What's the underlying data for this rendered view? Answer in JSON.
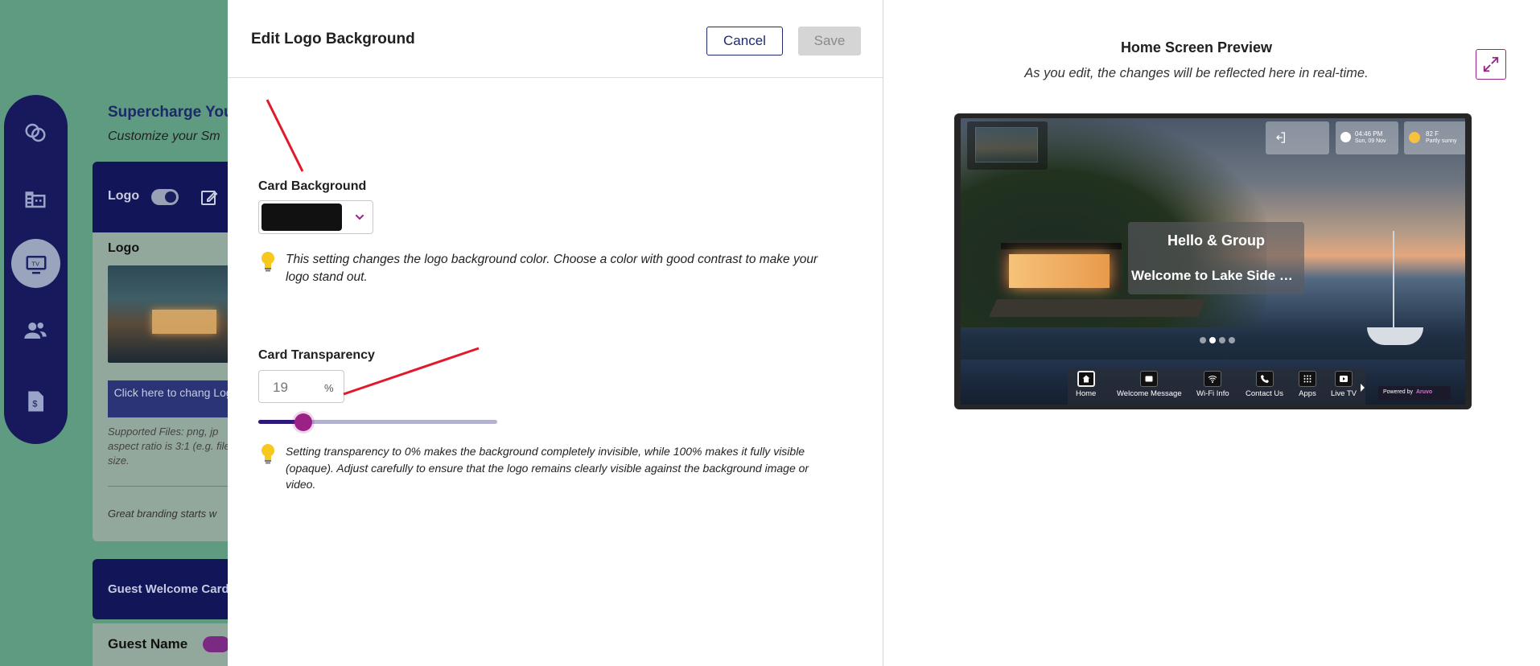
{
  "background_page": {
    "title": "Supercharge You",
    "subtitle": "Customize your Sm",
    "logo_section": {
      "header_label": "Logo",
      "title": "Logo",
      "change_button": "Click here to chang Logo",
      "supported_files": "Supported Files: png, jp aspect ratio is 3:1 (e.g. file size.",
      "branding_text": "Great branding starts w"
    },
    "guest_card_header": "Guest Welcome Card",
    "guest_name_label": "Guest Name",
    "rail_icons": [
      "rings-icon",
      "building-icon",
      "tv-icon",
      "users-icon",
      "invoice-icon"
    ]
  },
  "editor": {
    "title": "Edit Logo Background",
    "cancel_label": "Cancel",
    "save_label": "Save",
    "card_background_label": "Card Background",
    "card_background_color": "#111111",
    "card_background_tip": "This setting changes the logo background color. Choose a color with good contrast to make your logo stand out.",
    "card_transparency_label": "Card Transparency",
    "transparency_value": "19",
    "transparency_unit": "%",
    "transparency_level": 0.19,
    "transparency_tip": "Setting transparency to 0% makes the background completely invisible, while 100% makes it fully visible (opaque). Adjust carefully to ensure that the logo remains clearly visible against the background image or video."
  },
  "preview": {
    "title": "Home Screen Preview",
    "subtitle": "As you edit, the changes will be reflected here in real-time.",
    "tv": {
      "time": "04:46 PM",
      "date": "Sun, 09 Nov",
      "temperature": "82 F",
      "condition": "Partly sunny",
      "greeting": "Hello & Group",
      "welcome": "Welcome to Lake Side Cottage",
      "nav_items": [
        "Home",
        "Welcome Message",
        "Wi-Fi Info",
        "Contact Us",
        "Apps",
        "Live TV"
      ],
      "powered_by": "Powered by",
      "brand": "Aruvo"
    }
  },
  "colors": {
    "accent": "#9b2186",
    "navy": "#1f2a6b",
    "backdrop_green": "#5e9b80"
  }
}
